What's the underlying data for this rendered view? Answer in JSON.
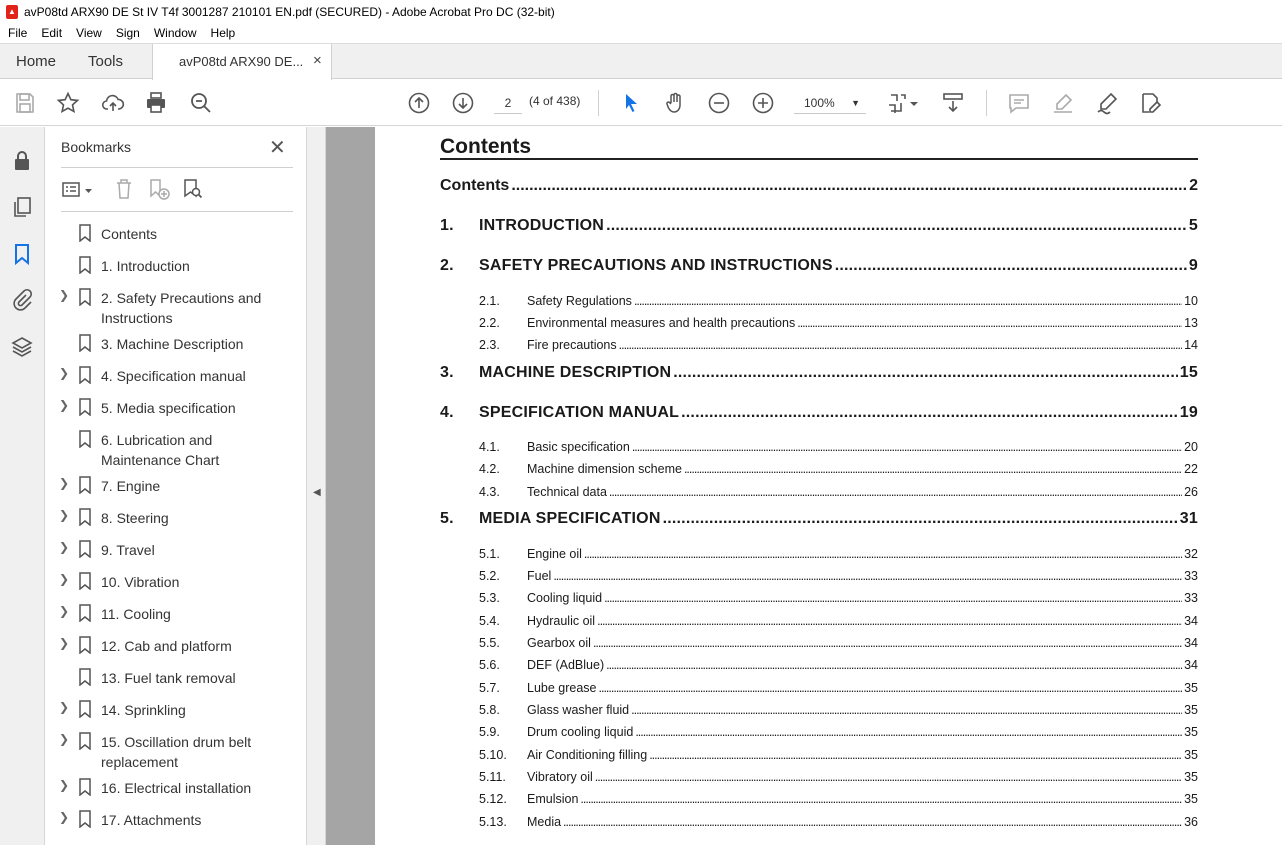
{
  "window": {
    "title": "avP08td ARX90 DE St IV T4f 3001287 210101 EN.pdf (SECURED) - Adobe Acrobat Pro DC (32-bit)"
  },
  "menu": [
    "File",
    "Edit",
    "View",
    "Sign",
    "Window",
    "Help"
  ],
  "tabs": {
    "home": "Home",
    "tools": "Tools",
    "document": "avP08td ARX90 DE...",
    "close": "×"
  },
  "toolbar": {
    "page_number": "2",
    "page_of": "(4 of 438)",
    "zoom": "100%"
  },
  "bookmarks_panel": {
    "title": "Bookmarks",
    "close": "✕",
    "items": [
      {
        "label": "Contents",
        "expandable": false,
        "lines": 1
      },
      {
        "label": "1. Introduction",
        "expandable": false,
        "lines": 1
      },
      {
        "label": "2. Safety Precautions and Instructions",
        "expandable": true,
        "lines": 2
      },
      {
        "label": "3. Machine Description",
        "expandable": false,
        "lines": 1
      },
      {
        "label": "4. Specification manual",
        "expandable": true,
        "lines": 1
      },
      {
        "label": "5. Media specification",
        "expandable": true,
        "lines": 1
      },
      {
        "label": "6. Lubrication and Maintenance Chart",
        "expandable": false,
        "lines": 2
      },
      {
        "label": "7. Engine",
        "expandable": true,
        "lines": 1
      },
      {
        "label": "8. Steering",
        "expandable": true,
        "lines": 1
      },
      {
        "label": "9. Travel",
        "expandable": true,
        "lines": 1
      },
      {
        "label": "10. Vibration",
        "expandable": true,
        "lines": 1
      },
      {
        "label": "11. Cooling",
        "expandable": true,
        "lines": 1
      },
      {
        "label": "12. Cab and platform",
        "expandable": true,
        "lines": 1
      },
      {
        "label": "13. Fuel tank removal",
        "expandable": false,
        "lines": 1
      },
      {
        "label": "14. Sprinkling",
        "expandable": true,
        "lines": 1
      },
      {
        "label": "15. Oscillation drum belt replacement",
        "expandable": true,
        "lines": 2
      },
      {
        "label": "16. Electrical installation",
        "expandable": true,
        "lines": 1
      },
      {
        "label": "17. Attachments",
        "expandable": true,
        "lines": 1
      }
    ]
  },
  "document": {
    "heading": "Contents",
    "toc": [
      {
        "level": "top",
        "num": "",
        "title": "Contents",
        "page": "2"
      },
      {
        "level": "major",
        "num": "1.",
        "title": "INTRODUCTION",
        "page": "5"
      },
      {
        "level": "major",
        "num": "2.",
        "title": "SAFETY PRECAUTIONS AND INSTRUCTIONS",
        "page": "9"
      },
      {
        "level": "minor",
        "num": "2.1.",
        "title": "Safety Regulations",
        "page": "10"
      },
      {
        "level": "minor",
        "num": "2.2.",
        "title": "Environmental measures and health precautions",
        "page": "13"
      },
      {
        "level": "minor",
        "num": "2.3.",
        "title": "Fire precautions",
        "page": "14"
      },
      {
        "level": "major",
        "num": "3.",
        "title": "MACHINE DESCRIPTION",
        "page": "15"
      },
      {
        "level": "major",
        "num": "4.",
        "title": "SPECIFICATION MANUAL",
        "page": "19"
      },
      {
        "level": "minor",
        "num": "4.1.",
        "title": "Basic specification",
        "page": "20"
      },
      {
        "level": "minor",
        "num": "4.2.",
        "title": "Machine dimension scheme",
        "page": "22"
      },
      {
        "level": "minor",
        "num": "4.3.",
        "title": "Technical data",
        "page": "26"
      },
      {
        "level": "major",
        "num": "5.",
        "title": "MEDIA SPECIFICATION",
        "page": "31"
      },
      {
        "level": "minor",
        "num": "5.1.",
        "title": "Engine oil",
        "page": "32"
      },
      {
        "level": "minor",
        "num": "5.2.",
        "title": "Fuel",
        "page": "33"
      },
      {
        "level": "minor",
        "num": "5.3.",
        "title": "Cooling liquid",
        "page": "33"
      },
      {
        "level": "minor",
        "num": "5.4.",
        "title": "Hydraulic oil",
        "page": "34"
      },
      {
        "level": "minor",
        "num": "5.5.",
        "title": "Gearbox oil",
        "page": "34"
      },
      {
        "level": "minor",
        "num": "5.6.",
        "title": "DEF (AdBlue)",
        "page": "34"
      },
      {
        "level": "minor",
        "num": "5.7.",
        "title": "Lube grease",
        "page": "35"
      },
      {
        "level": "minor",
        "num": "5.8.",
        "title": "Glass washer fluid",
        "page": "35"
      },
      {
        "level": "minor",
        "num": "5.9.",
        "title": "Drum cooling liquid",
        "page": "35"
      },
      {
        "level": "minor",
        "num": "5.10.",
        "title": "Air Conditioning filling",
        "page": "35"
      },
      {
        "level": "minor",
        "num": "5.11.",
        "title": "Vibratory oil",
        "page": "35"
      },
      {
        "level": "minor",
        "num": "5.12.",
        "title": "Emulsion",
        "page": "35"
      },
      {
        "level": "minor",
        "num": "5.13.",
        "title": "Media",
        "page": "36"
      }
    ]
  }
}
